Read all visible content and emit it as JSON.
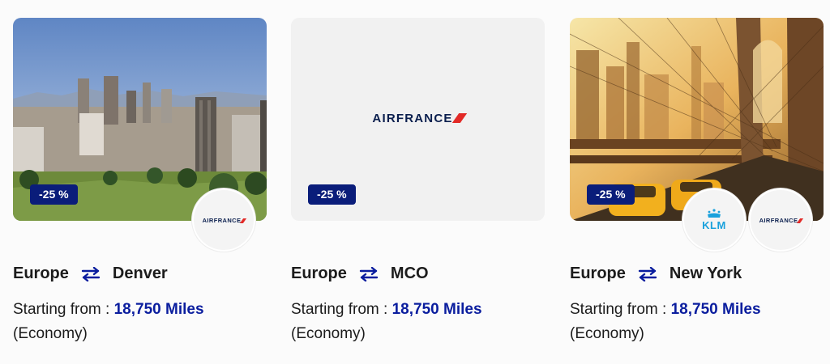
{
  "cards": [
    {
      "origin": "Europe",
      "destination": "Denver",
      "discount": "-25 %",
      "price_prefix": "Starting from :",
      "price": "18,750 Miles",
      "cabin": "(Economy)",
      "airlines": [
        "AIRFRANCE"
      ]
    },
    {
      "origin": "Europe",
      "destination": "MCO",
      "discount": "-25 %",
      "price_prefix": "Starting from :",
      "price": "18,750 Miles",
      "cabin": "(Economy)",
      "logo_text": "AIRFRANCE"
    },
    {
      "origin": "Europe",
      "destination": "New York",
      "discount": "-25 %",
      "price_prefix": "Starting from :",
      "price": "18,750 Miles",
      "cabin": "(Economy)",
      "airlines": [
        "KLM",
        "AIRFRANCE"
      ]
    }
  ],
  "colors": {
    "badge": "#0a1d7a",
    "miles": "#0a1d9e",
    "swap_icon": "#0a1d9e",
    "airfrance_red": "#e22a27",
    "klm_blue": "#1aa1dc"
  },
  "icons": {
    "swap": "swap-arrows-icon"
  }
}
